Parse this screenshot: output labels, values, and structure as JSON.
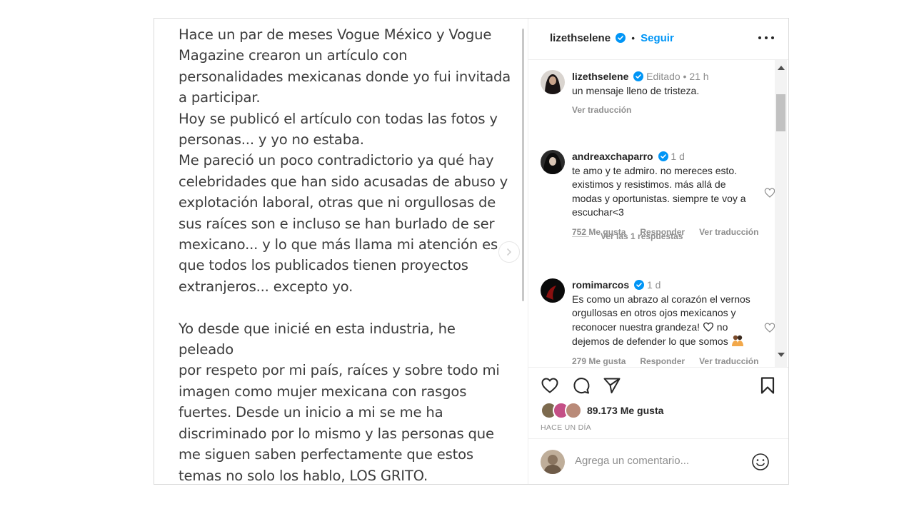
{
  "media": {
    "paragraph1": "Hace un par de meses Vogue México y Vogue\nMagazine crearon un artículo con\npersonalidades mexicanas donde yo fui invitada\na participar.\nHoy se publicó el artículo con todas las fotos y\npersonas... y yo no estaba.\nMe pareció un poco contradictorio ya qué hay\ncelebridades que han sido acusadas de abuso y\nexplotación laboral, otras que ni orgullosas de\nsus raíces son e incluso se han burlado de ser\nmexicano... y lo que más llama mi atención es\nque todos los publicados tienen proyectos\nextranjeros... excepto yo.",
    "paragraph2": "Yo desde que inicié en esta industria, he peleado\npor respeto por mi país, raíces y sobre todo mi\nimagen como mujer mexicana con rasgos\nfuertes. Desde un inicio a mi se me ha\ndiscriminado por lo mismo y las personas que\nme siguen saben perfectamente que estos\ntemas no solo los hablo, LOS GRITO."
  },
  "header": {
    "username": "lizethselene",
    "dot": "•",
    "follow_label": "Seguir"
  },
  "comments": [
    {
      "username": "lizethselene",
      "meta": "Editado • 21 h",
      "text": "un mensaje lleno de tristeza.",
      "translate": "Ver traducción"
    },
    {
      "username": "andreaxchaparro",
      "meta": "1 d",
      "text": "te amo y te admiro. no mereces esto. existimos y resistimos. más allá de modas y oportunistas. siempre te voy a escuchar<3",
      "likes": "752 Me gusta",
      "reply": "Responder",
      "translate": "Ver traducción",
      "view_replies": "Ver las 1 respuestas"
    },
    {
      "username": "romimarcos",
      "meta": "1 d",
      "text_before": "Es como un abrazo al corazón el vernos orgullosas en otros ojos mexicanos y reconocer nuestra grandeza!",
      "text_after": "no dejemos de defender lo que somos",
      "likes": "279 Me gusta",
      "reply": "Responder",
      "translate": "Ver traducción"
    }
  ],
  "actions": {
    "likes_count": "89.173 Me gusta",
    "time_ago": "HACE UN DÍA"
  },
  "add_comment": {
    "placeholder": "Agrega un comentario..."
  },
  "colors": {
    "accent": "#0095f6",
    "muted": "#8e8e8e",
    "text": "#262626"
  }
}
